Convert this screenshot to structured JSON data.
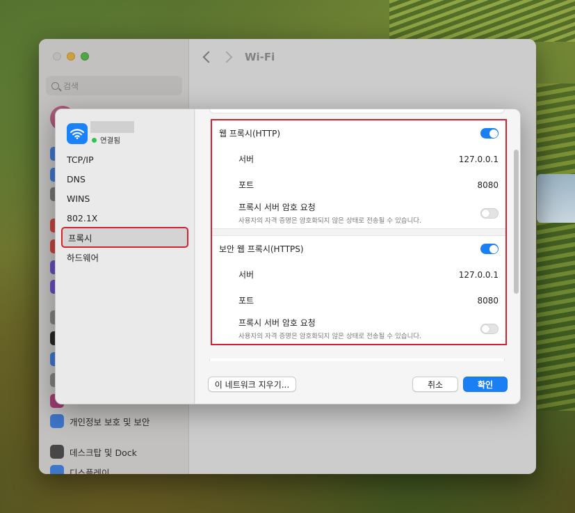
{
  "background": {
    "sidebar_items": [
      {
        "label": "개인정보 보호 및 보안",
        "icon": "hand-icon",
        "color": "#4a8df0"
      },
      {
        "label": "데스크탑 및 Dock",
        "icon": "dock-icon",
        "color": "#555555"
      },
      {
        "label": "디스플레이",
        "icon": "display-icon",
        "color": "#4a8df0"
      }
    ],
    "search_placeholder": "검색",
    "main_title": "Wi-Fi"
  },
  "sheet": {
    "network": {
      "status": "연결됨"
    },
    "nav": [
      {
        "label": "TCP/IP",
        "selected": false
      },
      {
        "label": "DNS",
        "selected": false
      },
      {
        "label": "WINS",
        "selected": false
      },
      {
        "label": "802.1X",
        "selected": false
      },
      {
        "label": "프록시",
        "selected": true
      },
      {
        "label": "하드웨어",
        "selected": false
      }
    ],
    "http_proxy": {
      "title": "웹 프록시(HTTP)",
      "enabled": true,
      "server_label": "서버",
      "server_value": "127.0.0.1",
      "port_label": "포트",
      "port_value": "8080",
      "password_label": "프록시 서버 암호 요청",
      "password_desc": "사용자의 자격 증명은 암호화되지 않은 상태로 전송될 수 있습니다.",
      "password_enabled": false
    },
    "https_proxy": {
      "title": "보안 웹 프록시(HTTPS)",
      "enabled": true,
      "server_label": "서버",
      "server_value": "127.0.0.1",
      "port_label": "포트",
      "port_value": "8080",
      "password_label": "프록시 서버 암호 요청",
      "password_desc": "사용자의 자격 증명은 암호화되지 않은 상태로 전송될 수 있습니다.",
      "password_enabled": false
    },
    "buttons": {
      "forget": "이 네트워크 지우기...",
      "cancel": "취소",
      "ok": "확인"
    }
  },
  "colors": {
    "accent": "#1a7ff2",
    "highlight_border": "#d6202e",
    "connected": "#32c24d"
  }
}
